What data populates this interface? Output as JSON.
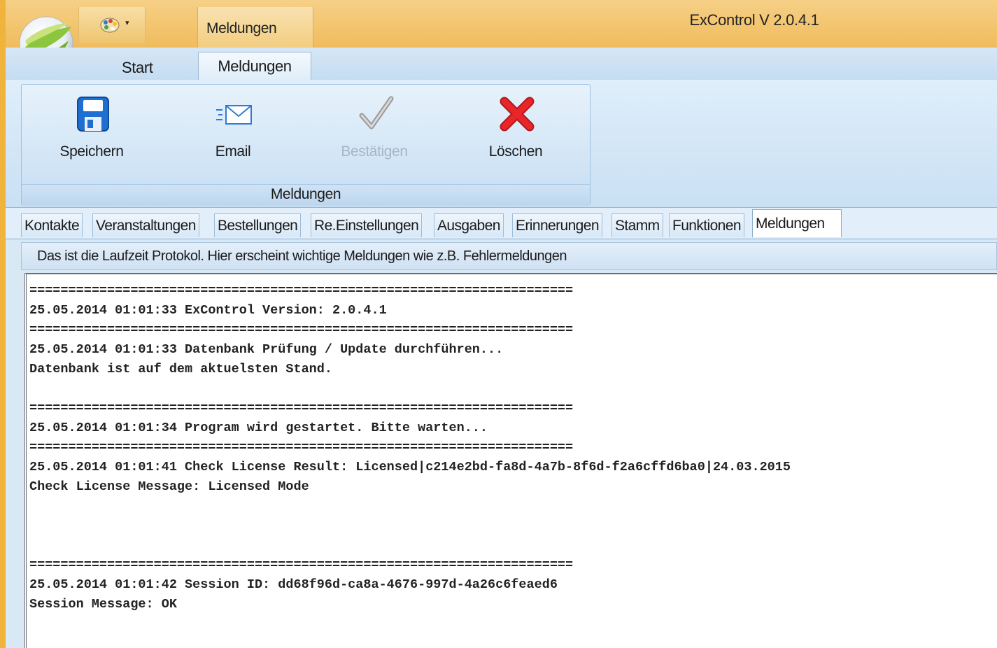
{
  "titlebar": {
    "app_title": "ExControl V 2.0.4.1",
    "context_tab": "Meldungen",
    "qat_arrow": "▾"
  },
  "ribbon": {
    "tabs": [
      {
        "label": "Start",
        "active": false
      },
      {
        "label": "Meldungen",
        "active": true
      }
    ],
    "group_label": "Meldungen",
    "buttons": [
      {
        "label": "Speichern",
        "icon": "save-icon",
        "enabled": true
      },
      {
        "label": "Email",
        "icon": "email-icon",
        "enabled": true
      },
      {
        "label": "Bestätigen",
        "icon": "checkmark-icon",
        "enabled": false
      },
      {
        "label": "Löschen",
        "icon": "delete-x-icon",
        "enabled": true
      }
    ]
  },
  "doc_tabs": [
    {
      "label": "Kontakte",
      "active": false
    },
    {
      "label": "Veranstaltungen",
      "active": false
    },
    {
      "label": "Bestellungen",
      "active": false
    },
    {
      "label": "Re.Einstellungen",
      "active": false
    },
    {
      "label": "Ausgaben",
      "active": false
    },
    {
      "label": "Erinnerungen",
      "active": false
    },
    {
      "label": "Stamm",
      "active": false
    },
    {
      "label": "Funktionen",
      "active": false
    },
    {
      "label": "Meldungen",
      "active": true
    }
  ],
  "info_text": "Das ist die Laufzeit Protokol. Hier erscheint wichtige Meldungen wie z.B. Fehlermeldungen",
  "log_lines": [
    "======================================================================",
    "25.05.2014 01:01:33 ExControl Version: 2.0.4.1",
    "======================================================================",
    "25.05.2014 01:01:33 Datenbank Prüfung / Update durchführen...",
    "Datenbank ist auf dem aktuelsten Stand.",
    "",
    "======================================================================",
    "25.05.2014 01:01:34 Program wird gestartet. Bitte warten...",
    "======================================================================",
    "25.05.2014 01:01:41 Check License Result: Licensed|c214e2bd-fa8d-4a7b-8f6d-f2a6cffd6ba0|24.03.2015",
    "Check License Message: Licensed Mode",
    "",
    "",
    "",
    "======================================================================",
    "25.05.2014 01:01:42 Session ID: dd68f96d-ca8a-4676-997d-4a26c6feaed6",
    "Session Message: OK"
  ],
  "colors": {
    "titlebar": "#f0bc5c",
    "ribbon": "#c9e0f4",
    "delete_red": "#e8262a",
    "save_blue": "#1e6fd1"
  }
}
